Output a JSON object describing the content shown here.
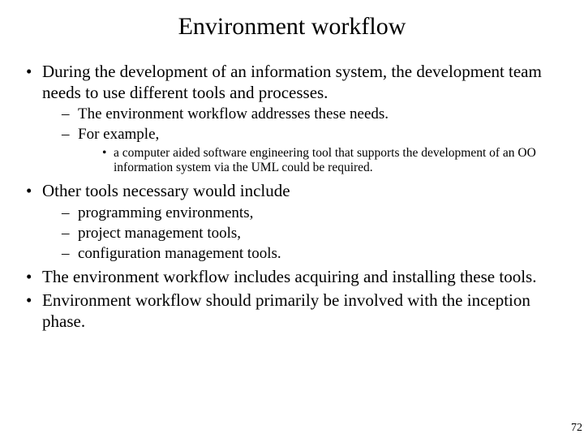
{
  "title": "Environment workflow",
  "bullets": {
    "b1": "During the development of an information system, the development team needs to use different tools and processes.",
    "b1_sub1": "The environment workflow addresses these needs.",
    "b1_sub2": "For example,",
    "b1_sub2_sub1": "a computer aided software engineering tool that supports the development of an OO information system via the UML could be required.",
    "b2": "Other tools necessary would include",
    "b2_sub1": "programming environments,",
    "b2_sub2": "project management tools,",
    "b2_sub3": "configuration management tools.",
    "b3": "The environment workflow includes acquiring and installing these tools.",
    "b4": "Environment workflow should primarily be involved with the inception phase."
  },
  "page_number": "72"
}
